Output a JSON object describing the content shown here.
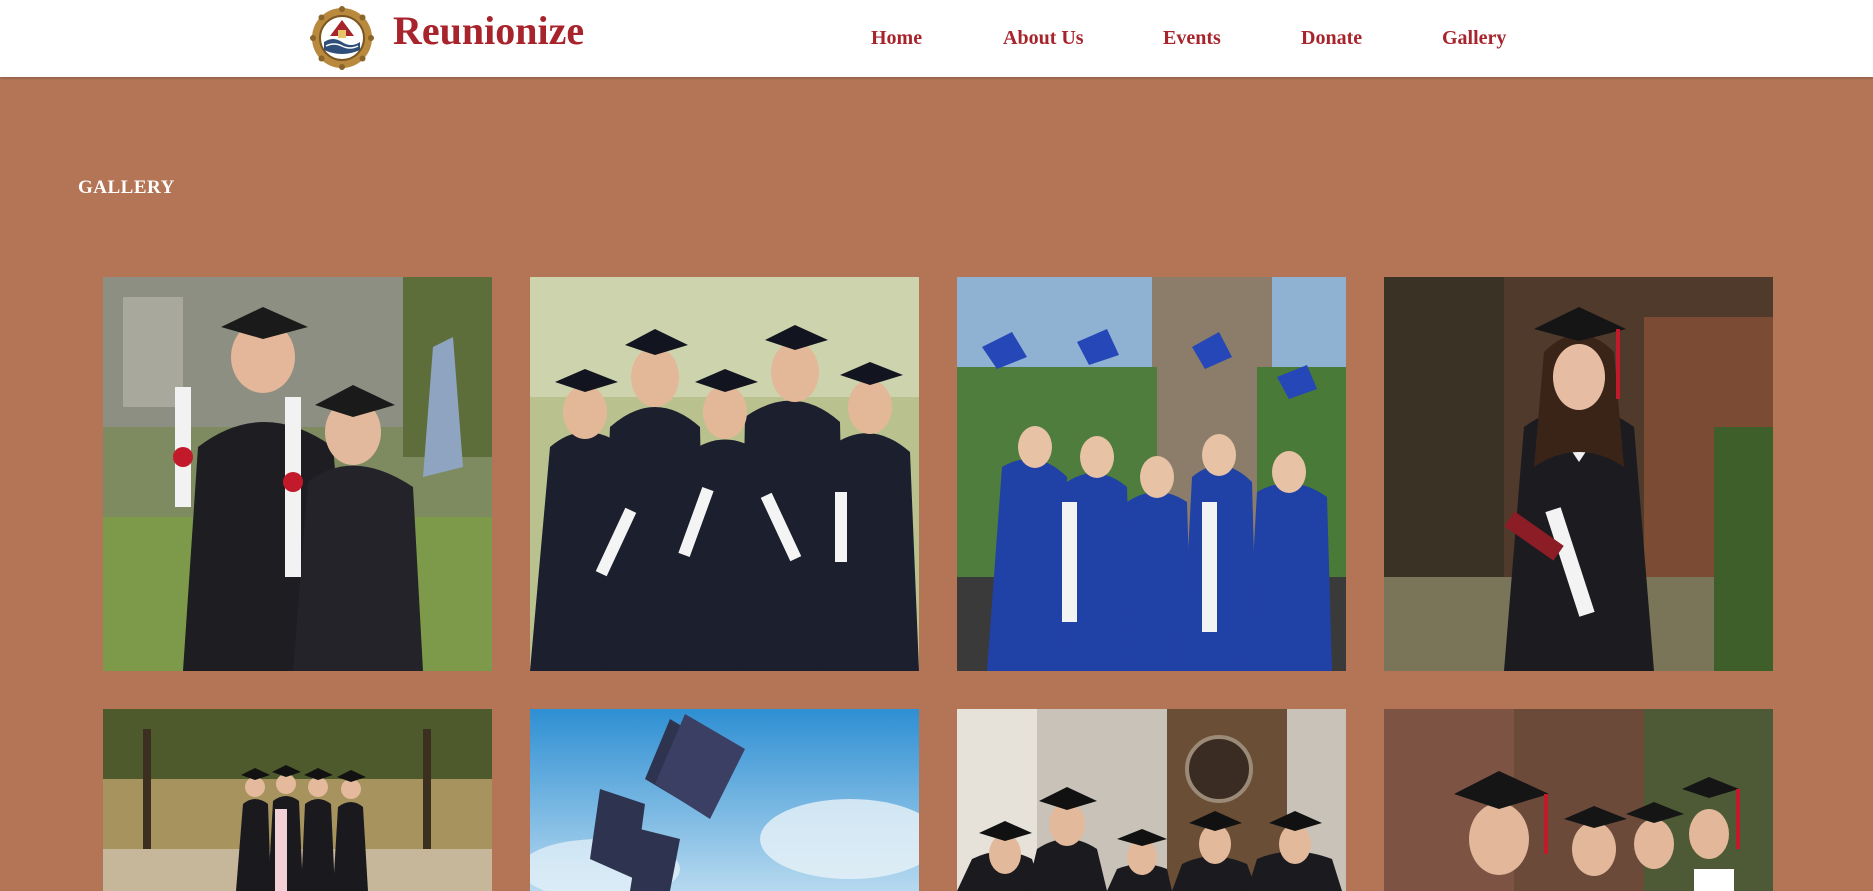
{
  "brand": {
    "name": "Reunionize",
    "logo_icon": "seal-logo-icon"
  },
  "nav": {
    "items": [
      {
        "label": "Home"
      },
      {
        "label": "About Us"
      },
      {
        "label": "Events"
      },
      {
        "label": "Donate"
      },
      {
        "label": "Gallery"
      }
    ]
  },
  "gallery": {
    "title": "GALLERY",
    "photos": [
      {
        "subject": "two graduates celebrating with diplomas"
      },
      {
        "subject": "five graduates in black gowns"
      },
      {
        "subject": "five graduates in blue gowns tossing caps"
      },
      {
        "subject": "female graduate holding diploma"
      },
      {
        "subject": "four graduates walking in park"
      },
      {
        "subject": "graduation caps thrown in blue sky"
      },
      {
        "subject": "group of graduates in front of building"
      },
      {
        "subject": "group of smiling graduates"
      }
    ]
  },
  "colors": {
    "brand_red": "#a8242c",
    "page_background": "#b47556",
    "header_background": "#ffffff"
  }
}
